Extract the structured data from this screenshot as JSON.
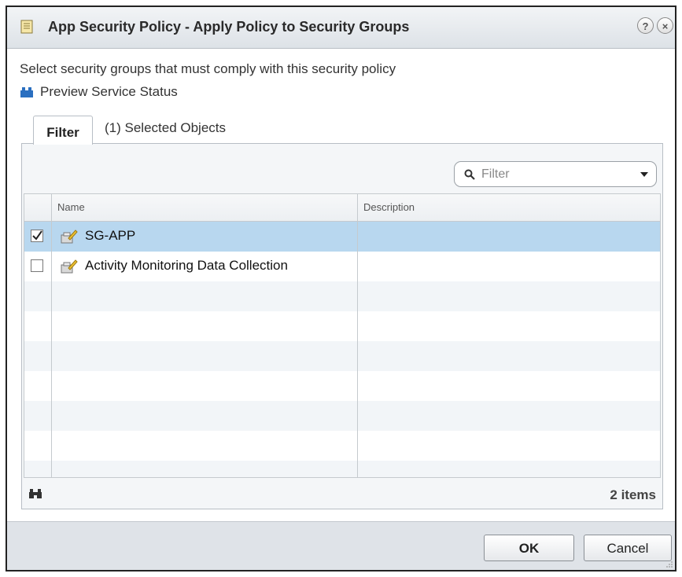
{
  "dialog": {
    "title": "App Security Policy - Apply Policy to Security Groups",
    "help_icon": "help-icon",
    "close_icon": "close-icon"
  },
  "instructions": "Select security groups that must comply with this security policy",
  "preview_link": "Preview Service Status",
  "tabs": [
    {
      "label": "Filter",
      "active": true
    },
    {
      "label": "(1) Selected Objects",
      "active": false
    }
  ],
  "filter": {
    "placeholder": "Filter"
  },
  "table": {
    "columns": [
      "Name",
      "Description"
    ],
    "rows": [
      {
        "name": "SG-APP",
        "description": "",
        "checked": true,
        "selected": true
      },
      {
        "name": "Activity Monitoring Data Collection",
        "description": "",
        "checked": false,
        "selected": false
      }
    ]
  },
  "footer": {
    "item_count": "2 items"
  },
  "buttons": {
    "ok": "OK",
    "cancel": "Cancel"
  },
  "colors": {
    "selected_row": "#b8d7ef",
    "title_bg": "#dde2e7"
  }
}
